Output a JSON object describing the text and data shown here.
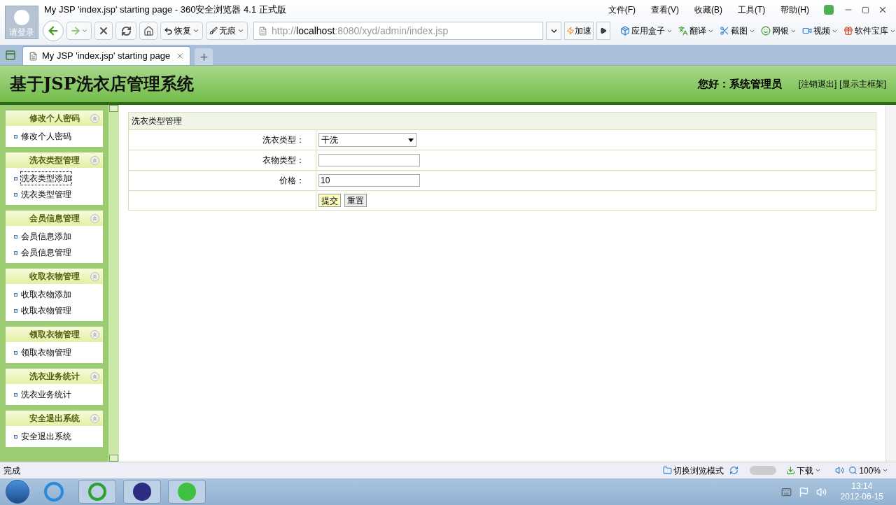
{
  "window": {
    "title": "My JSP 'index.jsp' starting page - 360安全浏览器 4.1 正式版",
    "login_label": "请登录"
  },
  "menu": [
    "文件(F)",
    "查看(V)",
    "收藏(B)",
    "工具(T)",
    "帮助(H)"
  ],
  "toolbar": {
    "restore": "恢复",
    "private": "无痕",
    "accelerate": "加速"
  },
  "address": {
    "scheme": "http://",
    "host": "localhost",
    "path": ":8080/xyd/admin/index.jsp"
  },
  "tools": [
    "应用盒子",
    "翻译",
    "截图",
    "网银",
    "视频",
    "软件宝库"
  ],
  "tabs": [
    {
      "label": "My JSP 'index.jsp' starting page",
      "selected": true
    }
  ],
  "header": {
    "title": "基于JSP洗衣店管理系统",
    "greeting": "您好：系统管理员",
    "links": [
      "[注销退出]",
      "[显示主框架]"
    ]
  },
  "sidebar": [
    {
      "title": "修改个人密码",
      "items": [
        {
          "label": "修改个人密码",
          "focused": false
        }
      ]
    },
    {
      "title": "洗衣类型管理",
      "items": [
        {
          "label": "洗衣类型添加",
          "focused": true
        },
        {
          "label": "洗衣类型管理",
          "focused": false
        }
      ]
    },
    {
      "title": "会员信息管理",
      "items": [
        {
          "label": "会员信息添加",
          "focused": false
        },
        {
          "label": "会员信息管理",
          "focused": false
        }
      ]
    },
    {
      "title": "收取衣物管理",
      "items": [
        {
          "label": "收取衣物添加",
          "focused": false
        },
        {
          "label": "收取衣物管理",
          "focused": false
        }
      ]
    },
    {
      "title": "领取衣物管理",
      "items": [
        {
          "label": "领取衣物管理",
          "focused": false
        }
      ]
    },
    {
      "title": "洗衣业务统计",
      "items": [
        {
          "label": "洗衣业务统计",
          "focused": false
        }
      ]
    },
    {
      "title": "安全退出系统",
      "items": [
        {
          "label": "安全退出系统",
          "focused": false
        }
      ]
    }
  ],
  "form": {
    "title": "洗衣类型管理",
    "fields": [
      {
        "kind": "select",
        "label": "洗衣类型：",
        "value": "干洗"
      },
      {
        "kind": "text",
        "label": "衣物类型："
      },
      {
        "kind": "text",
        "label": "价格：",
        "value": "10"
      }
    ],
    "buttons": [
      {
        "label": "提交",
        "hovered": true
      },
      {
        "label": "重置",
        "hovered": false
      }
    ]
  },
  "status": {
    "text": "完成",
    "mode": "切换浏览模式",
    "download": "下载",
    "zoom": "100%"
  },
  "taskbar": {
    "time": "13:14",
    "date": "2012-06-15"
  }
}
